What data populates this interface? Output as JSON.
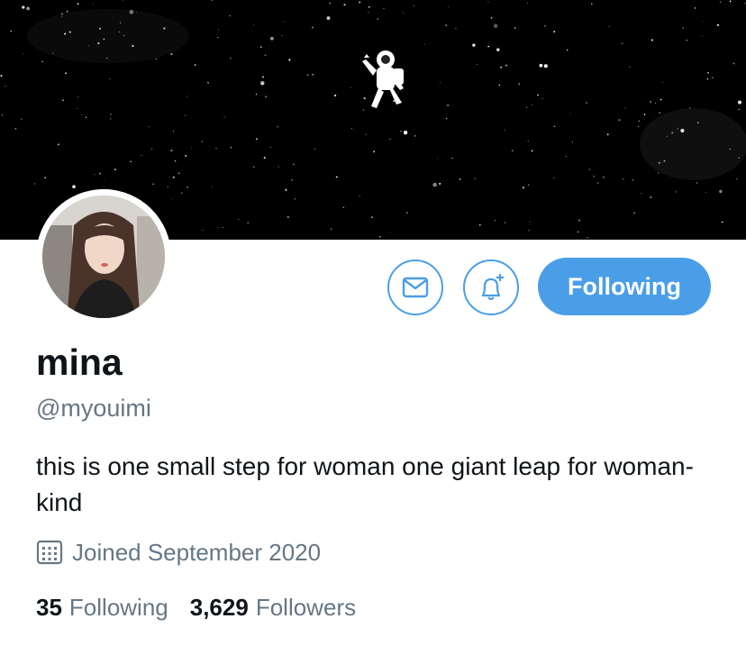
{
  "profile": {
    "display_name": "mina",
    "handle": "@myouimi",
    "bio": "this is one small step for woman one giant leap for woman-kind",
    "joined": "Joined September 2020"
  },
  "actions": {
    "message_icon": "envelope-icon",
    "notify_icon": "bell-plus-icon",
    "follow_label": "Following"
  },
  "stats": {
    "following_count": "35",
    "following_label": "Following",
    "followers_count": "3,629",
    "followers_label": "Followers"
  },
  "colors": {
    "accent": "#4a9ee8",
    "muted_text": "#657786",
    "banner_bg": "#000000"
  }
}
